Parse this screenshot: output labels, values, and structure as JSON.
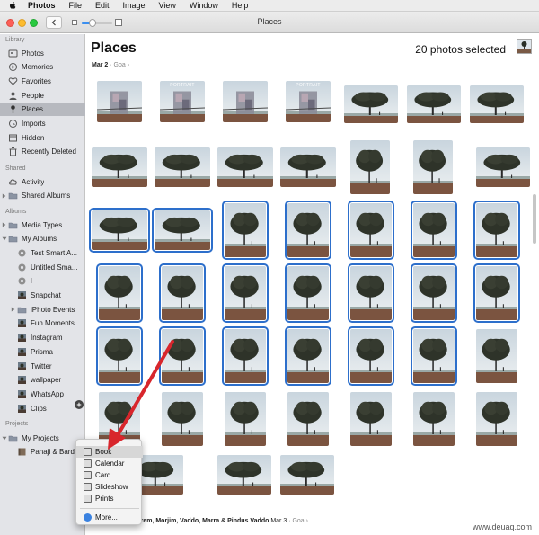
{
  "menubar": {
    "app": "Photos",
    "items": [
      "File",
      "Edit",
      "Image",
      "View",
      "Window",
      "Help"
    ]
  },
  "window": {
    "title": "Places"
  },
  "zoom": {
    "level": 0.35
  },
  "sidebar": {
    "sections": {
      "library": "Library",
      "shared": "Shared",
      "albums": "Albums",
      "projects": "Projects"
    },
    "library_items": [
      {
        "label": "Photos",
        "icon": "photos-icon"
      },
      {
        "label": "Memories",
        "icon": "memories-icon"
      },
      {
        "label": "Favorites",
        "icon": "heart-icon"
      },
      {
        "label": "People",
        "icon": "person-icon"
      },
      {
        "label": "Places",
        "icon": "pin-icon"
      },
      {
        "label": "Imports",
        "icon": "clock-icon"
      },
      {
        "label": "Hidden",
        "icon": "eye-icon"
      },
      {
        "label": "Recently Deleted",
        "icon": "trash-icon"
      }
    ],
    "shared_items": [
      {
        "label": "Activity",
        "icon": "cloud-icon"
      },
      {
        "label": "Shared Albums",
        "icon": "folder-icon"
      }
    ],
    "album_items": [
      {
        "label": "Media Types",
        "icon": "folder-icon"
      },
      {
        "label": "My Albums",
        "icon": "folder-icon"
      },
      {
        "label": "Test Smart A...",
        "icon": "gear-icon"
      },
      {
        "label": "Untitled Sma...",
        "icon": "gear-icon"
      },
      {
        "label": "l",
        "icon": "gear-icon"
      },
      {
        "label": "Snapchat",
        "icon": "album-icon"
      },
      {
        "label": "iPhoto Events",
        "icon": "folder-icon"
      },
      {
        "label": "Fun Moments",
        "icon": "album-icon"
      },
      {
        "label": "Instagram",
        "icon": "album-icon"
      },
      {
        "label": "Prisma",
        "icon": "album-icon"
      },
      {
        "label": "Twitter",
        "icon": "album-icon"
      },
      {
        "label": "wallpaper",
        "icon": "album-icon"
      },
      {
        "label": "WhatsApp",
        "icon": "album-icon"
      },
      {
        "label": "Clips",
        "icon": "album-icon"
      }
    ],
    "project_items": [
      {
        "label": "My Projects",
        "icon": "folder-icon"
      },
      {
        "label": "Panaji & Bardez",
        "icon": "book-icon"
      }
    ],
    "add_badge": "+"
  },
  "main": {
    "title": "Places",
    "selection": "20 photos selected",
    "breadcrumb_date": "Mar 2",
    "breadcrumb_place": "Goa",
    "breadcrumb_sep": "›",
    "footer_location": "Canacona, Mandrem, Morjim, Vaddo, Marra & Pindus Vaddo",
    "footer_date": "Mar 3",
    "footer_place": "Goa",
    "portrait_label": "PORTRAIT",
    "accent": "#2d6fcb"
  },
  "context_menu": {
    "items": [
      "Book",
      "Calendar",
      "Card",
      "Slideshow",
      "Prints"
    ],
    "more": "More..."
  },
  "watermark": "www.deuaq.com"
}
